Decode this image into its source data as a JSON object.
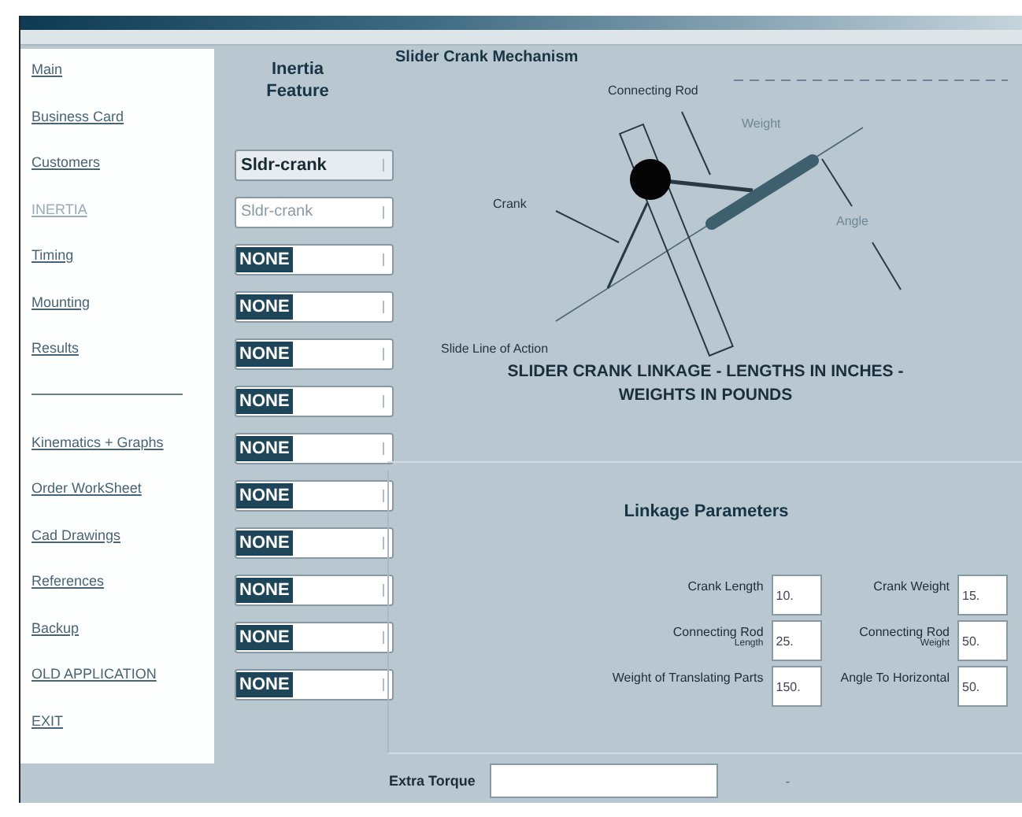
{
  "sidebar": {
    "groups": [
      [
        {
          "label": "Main",
          "selected": false
        },
        {
          "label": "Business Card",
          "selected": false
        },
        {
          "label": "Customers",
          "selected": false
        },
        {
          "label": "INERTIA",
          "selected": true
        },
        {
          "label": "Timing",
          "selected": false
        },
        {
          "label": "Mounting",
          "selected": false
        },
        {
          "label": "Results",
          "selected": false
        }
      ],
      [
        {
          "label": "Kinematics + Graphs",
          "selected": false
        },
        {
          "label": "Order WorkSheet",
          "selected": false
        },
        {
          "label": "Cad Drawings",
          "selected": false
        },
        {
          "label": "References",
          "selected": false
        },
        {
          "label": "Backup",
          "selected": false
        },
        {
          "label": "OLD APPLICATION",
          "selected": false
        },
        {
          "label": "EXIT",
          "selected": false
        }
      ]
    ]
  },
  "inertia_feature": {
    "title": "Inertia Feature",
    "dropdowns": [
      {
        "value": "Sldr-crank",
        "kind": "bold"
      },
      {
        "value": "Sldr-crank",
        "kind": "disabled"
      },
      {
        "value": "NONE",
        "kind": "highlighted"
      },
      {
        "value": "NONE",
        "kind": "highlighted"
      },
      {
        "value": "NONE",
        "kind": "highlighted"
      },
      {
        "value": "NONE",
        "kind": "highlighted"
      },
      {
        "value": "NONE",
        "kind": "highlighted"
      },
      {
        "value": "NONE",
        "kind": "highlighted"
      },
      {
        "value": "NONE",
        "kind": "highlighted"
      },
      {
        "value": "NONE",
        "kind": "highlighted"
      },
      {
        "value": "NONE",
        "kind": "highlighted"
      },
      {
        "value": "NONE",
        "kind": "highlighted"
      }
    ]
  },
  "mechanism": {
    "title": "Slider Crank Mechanism",
    "labels": {
      "connecting_rod": "Connecting Rod",
      "weight": "Weight",
      "crank": "Crank",
      "angle": "Angle",
      "slide_line": "Slide Line of Action"
    },
    "caption": "SLIDER CRANK LINKAGE - LENGTHS IN INCHES - WEIGHTS IN POUNDS"
  },
  "parameters": {
    "title": "Linkage Parameters",
    "columns": [
      [
        {
          "label": "Crank Length",
          "value": "10."
        },
        {
          "label": "Connecting Rod",
          "sublabel": "Length",
          "value": "25."
        },
        {
          "label": "Weight of Translating Parts",
          "value": "150."
        }
      ],
      [
        {
          "label": "Crank Weight",
          "value": "15."
        },
        {
          "label": "Connecting Rod",
          "sublabel": "Weight",
          "value": "50."
        },
        {
          "label": "Angle To Horizontal",
          "value": "50."
        }
      ]
    ]
  },
  "extra_torque": {
    "label": "Extra Torque",
    "unit": "-"
  }
}
